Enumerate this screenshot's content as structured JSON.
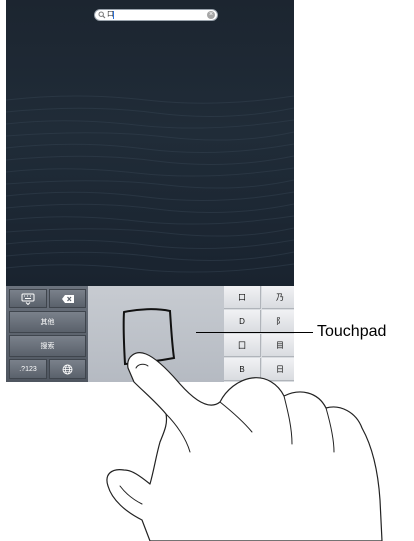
{
  "search": {
    "query": "口",
    "magnifier_icon": "magnifier-icon",
    "clear_icon": "clear-circle-icon"
  },
  "keyboard": {
    "hide_icon": "keyboard-hide-icon",
    "delete_icon": "delete-backspace-icon",
    "other_label": "其他",
    "search_label": "搜索",
    "number_label": ".?123",
    "globe_icon": "globe-icon",
    "candidates": [
      "口",
      "乃",
      "D",
      "阝",
      "囗",
      "目",
      "B",
      "日"
    ]
  },
  "callout": {
    "label": "Touchpad"
  }
}
